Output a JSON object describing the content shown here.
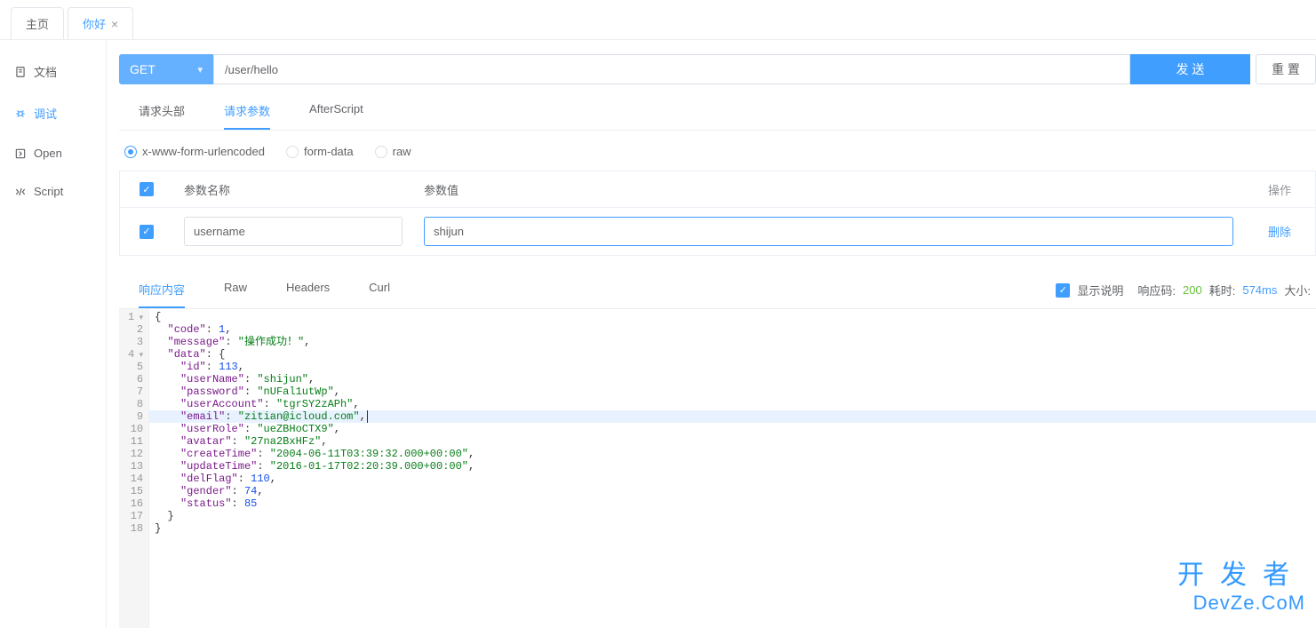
{
  "top_tabs": [
    {
      "label": "主页",
      "closable": false,
      "active": false
    },
    {
      "label": "你好",
      "closable": true,
      "active": true
    }
  ],
  "sidebar": {
    "items": [
      {
        "label": "文档",
        "icon": "doc-icon"
      },
      {
        "label": "调试",
        "icon": "debug-icon",
        "active": true
      },
      {
        "label": "Open",
        "icon": "open-icon"
      },
      {
        "label": "Script",
        "icon": "script-icon"
      }
    ]
  },
  "request": {
    "method": "GET",
    "url": "/user/hello",
    "send_label": "发 送",
    "reset_label": "重 置"
  },
  "request_tabs": [
    {
      "label": "请求头部",
      "active": false
    },
    {
      "label": "请求参数",
      "active": true
    },
    {
      "label": "AfterScript",
      "active": false
    }
  ],
  "body_types": [
    {
      "label": "x-www-form-urlencoded",
      "checked": true
    },
    {
      "label": "form-data",
      "checked": false
    },
    {
      "label": "raw",
      "checked": false
    }
  ],
  "params_table": {
    "header_name": "参数名称",
    "header_value": "参数值",
    "header_op": "操作",
    "delete_label": "删除",
    "rows": [
      {
        "name": "username",
        "value": "shijun",
        "checked": true,
        "value_focused": true
      }
    ]
  },
  "response_tabs": [
    {
      "label": "响应内容",
      "active": true
    },
    {
      "label": "Raw",
      "active": false
    },
    {
      "label": "Headers",
      "active": false
    },
    {
      "label": "Curl",
      "active": false
    }
  ],
  "response_meta": {
    "show_desc_checked": true,
    "show_desc_label": "显示说明",
    "code_label": "响应码:",
    "code_value": "200",
    "time_label": "耗时:",
    "time_value": "574ms",
    "size_label": "大小:"
  },
  "response_body": {
    "code": 1,
    "message": "操作成功！",
    "data": {
      "id": 113,
      "userName": "shijun",
      "password": "nUFal1utWp",
      "userAccount": "tgrSY2zAPh",
      "email": "zitian@icloud.com",
      "userRole": "ueZBHoCTX9",
      "avatar": "27na2BxHFz",
      "createTime": "2004-06-11T03:39:32.000+00:00",
      "updateTime": "2016-01-17T02:20:39.000+00:00",
      "delFlag": 110,
      "gender": 74,
      "status": 85
    }
  },
  "code_lines": [
    {
      "n": 1,
      "fold": true,
      "indent": 0,
      "type": "punc",
      "text": "{"
    },
    {
      "n": 2,
      "indent": 2,
      "key": "code",
      "vtype": "num",
      "val": "1",
      "comma": true
    },
    {
      "n": 3,
      "indent": 2,
      "key": "message",
      "vtype": "str",
      "val": "操作成功！",
      "comma": true
    },
    {
      "n": 4,
      "fold": true,
      "indent": 2,
      "key": "data",
      "vtype": "punc",
      "val": "{"
    },
    {
      "n": 5,
      "indent": 4,
      "key": "id",
      "vtype": "num",
      "val": "113",
      "comma": true
    },
    {
      "n": 6,
      "indent": 4,
      "key": "userName",
      "vtype": "str",
      "val": "shijun",
      "comma": true
    },
    {
      "n": 7,
      "indent": 4,
      "key": "password",
      "vtype": "str",
      "val": "nUFal1utWp",
      "comma": true
    },
    {
      "n": 8,
      "indent": 4,
      "key": "userAccount",
      "vtype": "str",
      "val": "tgrSY2zAPh",
      "comma": true
    },
    {
      "n": 9,
      "hl": true,
      "indent": 4,
      "key": "email",
      "vtype": "str",
      "val": "zitian@icloud.com",
      "comma": true,
      "caret": true
    },
    {
      "n": 10,
      "indent": 4,
      "key": "userRole",
      "vtype": "str",
      "val": "ueZBHoCTX9",
      "comma": true
    },
    {
      "n": 11,
      "indent": 4,
      "key": "avatar",
      "vtype": "str",
      "val": "27na2BxHFz",
      "comma": true
    },
    {
      "n": 12,
      "indent": 4,
      "key": "createTime",
      "vtype": "str",
      "val": "2004-06-11T03:39:32.000+00:00",
      "comma": true
    },
    {
      "n": 13,
      "indent": 4,
      "key": "updateTime",
      "vtype": "str",
      "val": "2016-01-17T02:20:39.000+00:00",
      "comma": true
    },
    {
      "n": 14,
      "indent": 4,
      "key": "delFlag",
      "vtype": "num",
      "val": "110",
      "comma": true
    },
    {
      "n": 15,
      "indent": 4,
      "key": "gender",
      "vtype": "num",
      "val": "74",
      "comma": true
    },
    {
      "n": 16,
      "indent": 4,
      "key": "status",
      "vtype": "num",
      "val": "85"
    },
    {
      "n": 17,
      "indent": 2,
      "type": "punc",
      "text": "}"
    },
    {
      "n": 18,
      "indent": 0,
      "type": "punc",
      "text": "}"
    }
  ],
  "watermark": {
    "line1": "开发者",
    "line2": "DevZe.CoM"
  }
}
